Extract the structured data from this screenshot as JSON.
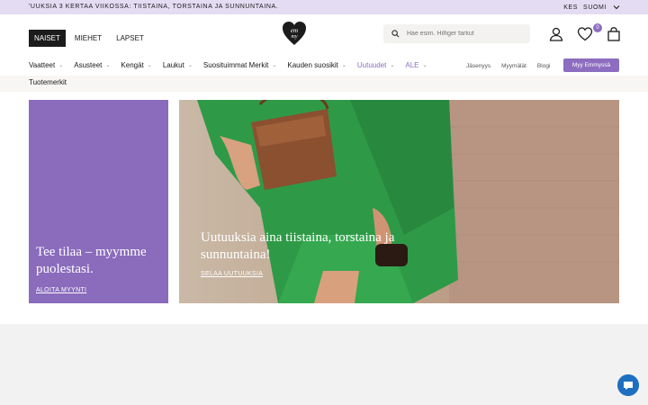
{
  "topbar": {
    "ticker": "'UUKSIA 3 KERTAA VIIKOSSA: TIISTAINA, TORSTAINA JA SUNNUNTAINA.",
    "currency": "KES",
    "language": "SUOMI"
  },
  "header": {
    "gender_tabs": [
      "NAISET",
      "MIEHET",
      "LAPSET"
    ],
    "logo_text": "em my",
    "search_placeholder": "Hae esim. Hilfiger farkut",
    "wishlist_count": "0"
  },
  "nav": {
    "items": [
      "Vaatteet",
      "Asusteet",
      "Kengät",
      "Laukut",
      "Suosituimmat Merkit",
      "Kauden suosikit",
      "Uutuudet",
      "ALE"
    ],
    "links": [
      "Jäsenyys",
      "Myymälät",
      "Blogi"
    ],
    "sell_button": "Myy Emmyssä",
    "subitem": "Tuotemerkit"
  },
  "promo": {
    "title": "Tee tilaa – myymme puolestasi.",
    "link": "ALOITA MYYNTI",
    "color": "#8a6bbc"
  },
  "hero": {
    "title": "Uutuuksia aina tiistaina, torstaina ja sunnuntaina!",
    "link": "SELAA UUTUUKSIA"
  },
  "colors": {
    "accent": "#8c6dbf",
    "topbar": "#e4dcf3",
    "chat": "#1f6fc1"
  }
}
